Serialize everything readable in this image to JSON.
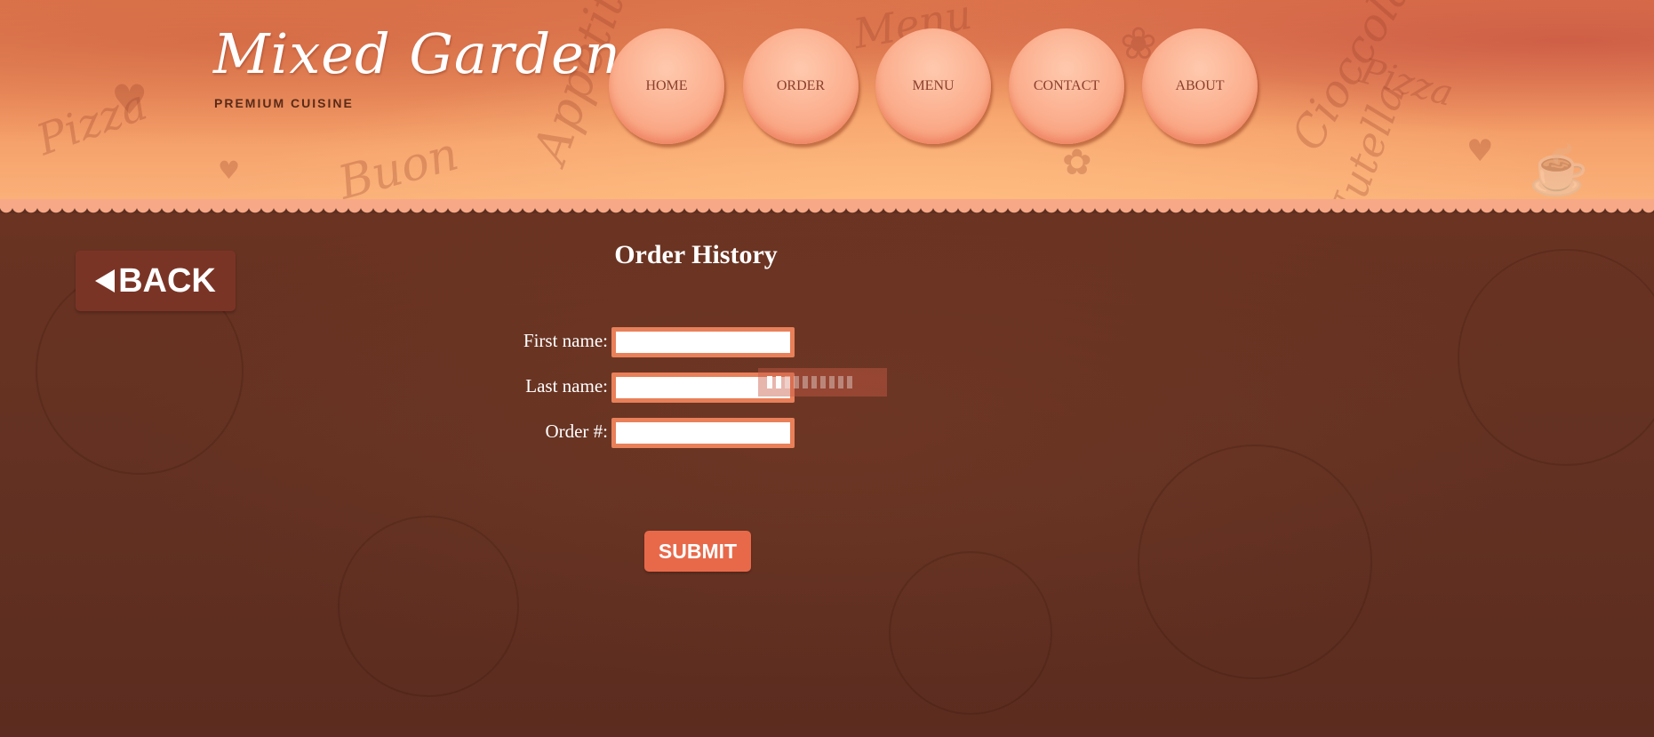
{
  "brand": {
    "title": "Mixed Garden",
    "subtitle": "PREMIUM CUISINE"
  },
  "nav": {
    "items": [
      {
        "label": "HOME"
      },
      {
        "label": "ORDER"
      },
      {
        "label": "MENU"
      },
      {
        "label": "CONTACT"
      },
      {
        "label": "ABOUT"
      }
    ]
  },
  "back": {
    "label": "BACK"
  },
  "page": {
    "title": "Order History"
  },
  "form": {
    "first_name": {
      "label": "First name:",
      "value": ""
    },
    "last_name": {
      "label": "Last name:",
      "value": ""
    },
    "order_number": {
      "label": "Order #:",
      "value": ""
    },
    "submit_label": "SUBMIT"
  },
  "colors": {
    "accent": "#e8694a",
    "input_border": "#e8805a",
    "header_peach": "#f39a65",
    "body_brown": "#5e2f20"
  }
}
